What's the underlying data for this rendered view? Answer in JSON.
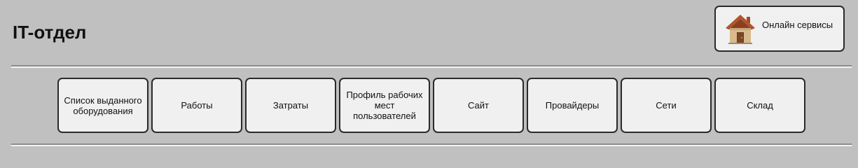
{
  "header": {
    "title": "IT-отдел"
  },
  "online_services": {
    "label": "Онлайн сервисы",
    "icon": "house-icon"
  },
  "nav": {
    "items": [
      {
        "id": "issued-equipment",
        "label": "Список выданного оборудования"
      },
      {
        "id": "works",
        "label": "Работы"
      },
      {
        "id": "expenses",
        "label": "Затраты"
      },
      {
        "id": "workstation-profile",
        "label": "Профиль рабочих мест пользователей"
      },
      {
        "id": "site",
        "label": "Сайт"
      },
      {
        "id": "providers",
        "label": "Провайдеры"
      },
      {
        "id": "networks",
        "label": "Сети"
      },
      {
        "id": "warehouse",
        "label": "Склад"
      }
    ]
  },
  "colors": {
    "background": "#c0c0c0",
    "button_face": "#f0f0f0",
    "button_border": "#2a2a2a"
  }
}
